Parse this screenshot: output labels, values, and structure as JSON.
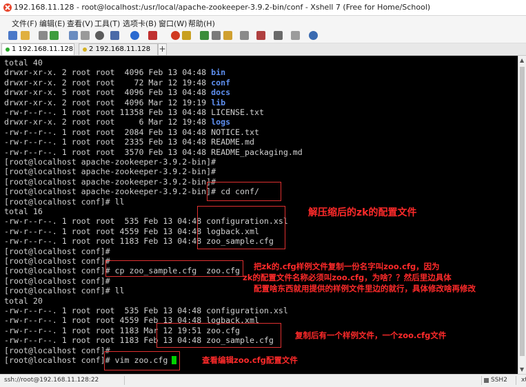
{
  "window": {
    "title": "192.168.11.128 - root@localhost:/usr/local/apache-zookeeper-3.9.2-bin/conf - Xshell 7 (Free for Home/School)"
  },
  "menu": [
    "文件(F)",
    "编辑(E)",
    "查看(V)",
    "工具(T)",
    "选项卡(B)",
    "窗口(W)",
    "帮助(H)"
  ],
  "toolbar_icons": [
    "new-session-icon",
    "open-folder-icon",
    "link-icon",
    "reconnect-icon",
    "copy-icon",
    "paste-icon",
    "find-icon",
    "layout-icon",
    "globe-icon",
    "font-icon",
    "xftp-icon",
    "xmanager-icon",
    "compose-icon",
    "fullscreen-icon",
    "lock-icon",
    "keyboard-icon",
    "highlight-icon",
    "scroll-lock-icon",
    "window-list-icon",
    "help-icon"
  ],
  "tabs": [
    {
      "label": "1 192.168.11.128",
      "active": true,
      "status_color": "#2aa82a"
    },
    {
      "label": "2 192.168.11.128",
      "active": false,
      "status_color": "#d4b020"
    }
  ],
  "add_tab_label": "+",
  "terminal": {
    "lines": [
      {
        "pre": "total 40",
        "dir": "",
        "post": ""
      },
      {
        "pre": "drwxr-xr-x. 2 root root  4096 Feb 13 04:48 ",
        "dir": "bin",
        "post": ""
      },
      {
        "pre": "drwxr-xr-x. 2 root root    72 Mar 12 19:48 ",
        "dir": "conf",
        "post": ""
      },
      {
        "pre": "drwxr-xr-x. 5 root root  4096 Feb 13 04:48 ",
        "dir": "docs",
        "post": ""
      },
      {
        "pre": "drwxr-xr-x. 2 root root  4096 Mar 12 19:19 ",
        "dir": "lib",
        "post": ""
      },
      {
        "pre": "-rw-r--r--. 1 root root 11358 Feb 13 04:48 LICENSE.txt",
        "dir": "",
        "post": ""
      },
      {
        "pre": "drwxr-xr-x. 2 root root     6 Mar 12 19:48 ",
        "dir": "logs",
        "post": ""
      },
      {
        "pre": "-rw-r--r--. 1 root root  2084 Feb 13 04:48 NOTICE.txt",
        "dir": "",
        "post": ""
      },
      {
        "pre": "-rw-r--r--. 1 root root  2335 Feb 13 04:48 README.md",
        "dir": "",
        "post": ""
      },
      {
        "pre": "-rw-r--r--. 1 root root  3570 Feb 13 04:48 README_packaging.md",
        "dir": "",
        "post": ""
      },
      {
        "pre": "[root@localhost apache-zookeeper-3.9.2-bin]#",
        "dir": "",
        "post": ""
      },
      {
        "pre": "[root@localhost apache-zookeeper-3.9.2-bin]#",
        "dir": "",
        "post": ""
      },
      {
        "pre": "[root@localhost apache-zookeeper-3.9.2-bin]#",
        "dir": "",
        "post": ""
      },
      {
        "pre": "[root@localhost apache-zookeeper-3.9.2-bin]# cd conf/",
        "dir": "",
        "post": ""
      },
      {
        "pre": "[root@localhost conf]# ll",
        "dir": "",
        "post": ""
      },
      {
        "pre": "total 16",
        "dir": "",
        "post": ""
      },
      {
        "pre": "-rw-r--r--. 1 root root  535 Feb 13 04:48 configuration.xsl",
        "dir": "",
        "post": ""
      },
      {
        "pre": "-rw-r--r--. 1 root root 4559 Feb 13 04:48 logback.xml",
        "dir": "",
        "post": ""
      },
      {
        "pre": "-rw-r--r--. 1 root root 1183 Feb 13 04:48 zoo_sample.cfg",
        "dir": "",
        "post": ""
      },
      {
        "pre": "[root@localhost conf]#",
        "dir": "",
        "post": ""
      },
      {
        "pre": "[root@localhost conf]#",
        "dir": "",
        "post": ""
      },
      {
        "pre": "[root@localhost conf]# cp zoo_sample.cfg  zoo.cfg",
        "dir": "",
        "post": ""
      },
      {
        "pre": "[root@localhost conf]#",
        "dir": "",
        "post": ""
      },
      {
        "pre": "[root@localhost conf]# ll",
        "dir": "",
        "post": ""
      },
      {
        "pre": "total 20",
        "dir": "",
        "post": ""
      },
      {
        "pre": "-rw-r--r--. 1 root root  535 Feb 13 04:48 configuration.xsl",
        "dir": "",
        "post": ""
      },
      {
        "pre": "-rw-r--r--. 1 root root 4559 Feb 13 04:48 logback.xml",
        "dir": "",
        "post": ""
      },
      {
        "pre": "-rw-r--r--. 1 root root 1183 Mar 12 19:51 zoo.cfg",
        "dir": "",
        "post": ""
      },
      {
        "pre": "-rw-r--r--. 1 root root 1183 Feb 13 04:48 zoo_sample.cfg",
        "dir": "",
        "post": ""
      },
      {
        "pre": "[root@localhost conf]#",
        "dir": "",
        "post": ""
      },
      {
        "pre": "[root@localhost conf]# vim zoo.cfg",
        "dir": "",
        "post": ""
      }
    ],
    "dir_color": "#5e8ff0",
    "text_color": "#cfcfcf",
    "cursor_color": "#00d000"
  },
  "annotations": {
    "color": "#ff2a2a",
    "notes": [
      {
        "text": "解压缩后的zk的配置文件"
      },
      {
        "text": "把zk的.cfg样例文件复制一份名字叫zoo.cfg，因为"
      },
      {
        "text": "zk的配置文件名称必须叫zoo.cfg，为啥？？然后里边具体"
      },
      {
        "text": "配置啥东西就用提供的样例文件里边的就行，具体修改啥再修改"
      },
      {
        "text": "复制后有一个样例文件，一个zoo.cfg文件"
      },
      {
        "text": "查看编辑zoo.cfg配置文件"
      }
    ]
  },
  "status": {
    "connection": "ssh://root@192.168.11.128:22",
    "protocol": "SSH2",
    "terminal": "xt"
  }
}
